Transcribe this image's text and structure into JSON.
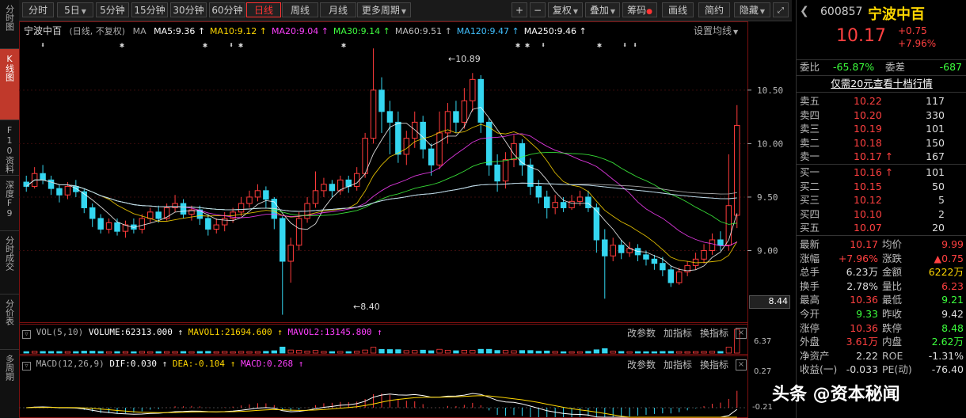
{
  "left_nav": [
    {
      "label": "分时图"
    },
    {
      "label": "K线图"
    },
    {
      "label": "F10资料"
    },
    {
      "label": "深度F9"
    },
    {
      "label": "分时成交"
    },
    {
      "label": "分价表"
    },
    {
      "label": "多周期"
    }
  ],
  "toolbar": {
    "periods": [
      "分时",
      "5日",
      "5分钟",
      "15分钟",
      "30分钟",
      "60分钟",
      "日线",
      "周线",
      "月线",
      "更多周期"
    ],
    "active_period": "日线",
    "right_buttons": [
      "复权",
      "叠加",
      "筹码",
      "画线",
      "简约",
      "隐藏"
    ],
    "plus": "+",
    "minus": "−"
  },
  "main_chart": {
    "title": "宁波中百",
    "subtitle": "(日线, 不复权)",
    "ma_label": "MA",
    "ma_items": [
      {
        "text": "MA5:9.36",
        "color": "#ffffff"
      },
      {
        "text": "MA10:9.12",
        "color": "#ffd700"
      },
      {
        "text": "MA20:9.04",
        "color": "#ff40ff"
      },
      {
        "text": "MA30:9.14",
        "color": "#40ff40"
      },
      {
        "text": "MA60:9.51",
        "color": "#c0c0c0"
      },
      {
        "text": "MA120:9.47",
        "color": "#40c0ff"
      },
      {
        "text": "MA250:9.46",
        "color": "#ffffff"
      }
    ],
    "settings_label": "设置均线",
    "y_ticks": [
      {
        "v": 10.5,
        "t": "10.50"
      },
      {
        "v": 10.0,
        "t": "10.00"
      },
      {
        "v": 9.5,
        "t": "9.50"
      },
      {
        "v": 9.0,
        "t": "9.00"
      }
    ],
    "y_range": [
      8.33,
      10.98
    ],
    "current_price_tag": "8.44",
    "high_annotation": "10.89",
    "low_annotation": "8.40"
  },
  "volume_panel": {
    "label": "VOL(5,10)",
    "volume": "VOLUME:62313.000",
    "mavol1": "MAVOL1:21694.600",
    "mavol2": "MAVOL2:13145.800",
    "ytick": "6.37",
    "buttons": [
      "改参数",
      "加指标",
      "换指标"
    ]
  },
  "macd_panel": {
    "label": "MACD(12,26,9)",
    "dif": "DIF:0.030",
    "dea": "DEA:-0.104",
    "macd": "MACD:0.268",
    "yticks": [
      "0.27",
      "-0.21"
    ],
    "buttons": [
      "改参数",
      "加指标",
      "换指标"
    ]
  },
  "quote": {
    "code": "600857",
    "name": "宁波中百",
    "price": "10.17",
    "change": "+0.75",
    "change_pct": "+7.96%",
    "weibi_label": "委比",
    "weibi": "-65.87%",
    "weicha_label": "委差",
    "weicha": "-687",
    "ten_level_link": "仅需20元查看十档行情",
    "sell": [
      {
        "label": "卖五",
        "price": "10.22",
        "vol": "117"
      },
      {
        "label": "卖四",
        "price": "10.20",
        "vol": "330"
      },
      {
        "label": "卖三",
        "price": "10.19",
        "vol": "101"
      },
      {
        "label": "卖二",
        "price": "10.18",
        "vol": "150"
      },
      {
        "label": "卖一",
        "price": "10.17",
        "vol": "167"
      }
    ],
    "buy": [
      {
        "label": "买一",
        "price": "10.16",
        "vol": "101"
      },
      {
        "label": "买二",
        "price": "10.15",
        "vol": "50"
      },
      {
        "label": "买三",
        "price": "10.12",
        "vol": "5"
      },
      {
        "label": "买四",
        "price": "10.10",
        "vol": "2"
      },
      {
        "label": "买五",
        "price": "10.07",
        "vol": "20"
      }
    ],
    "stats": [
      {
        "l1": "最新",
        "v1": "10.17",
        "c1": "red",
        "l2": "均价",
        "v2": "9.99",
        "c2": "red"
      },
      {
        "l1": "涨幅",
        "v1": "+7.96%",
        "c1": "red",
        "l2": "涨跌",
        "v2": "▲0.75",
        "c2": "red"
      },
      {
        "l1": "总手",
        "v1": "6.23万",
        "c1": "white",
        "l2": "金额",
        "v2": "6222万",
        "c2": "yellow"
      },
      {
        "l1": "换手",
        "v1": "2.78%",
        "c1": "white",
        "l2": "量比",
        "v2": "6.23",
        "c2": "red"
      },
      {
        "l1": "最高",
        "v1": "10.36",
        "c1": "red",
        "l2": "最低",
        "v2": "9.21",
        "c2": "green"
      },
      {
        "l1": "今开",
        "v1": "9.33",
        "c1": "green",
        "l2": "昨收",
        "v2": "9.42",
        "c2": "white"
      },
      {
        "l1": "涨停",
        "v1": "10.36",
        "c1": "red",
        "l2": "跌停",
        "v2": "8.48",
        "c2": "green"
      },
      {
        "l1": "外盘",
        "v1": "3.61万",
        "c1": "red",
        "l2": "内盘",
        "v2": "2.62万",
        "c2": "green"
      },
      {
        "l1": "净资产",
        "v1": "2.22",
        "c1": "white",
        "l2": "ROE",
        "v2": "-1.31%",
        "c2": "white"
      },
      {
        "l1": "收益(一)",
        "v1": "-0.033",
        "c1": "white",
        "l2": "PE(动)",
        "v2": "-76.40",
        "c2": "white"
      }
    ]
  },
  "watermark": "头条 @资本秘闻",
  "chart_data": {
    "type": "candlestick",
    "series": [
      {
        "o": 9.64,
        "c": 9.6,
        "h": 9.7,
        "l": 9.55
      },
      {
        "o": 9.6,
        "c": 9.72,
        "h": 9.78,
        "l": 9.58
      },
      {
        "o": 9.72,
        "c": 9.66,
        "h": 9.8,
        "l": 9.62
      },
      {
        "o": 9.66,
        "c": 9.58,
        "h": 9.7,
        "l": 9.52
      },
      {
        "o": 9.58,
        "c": 9.52,
        "h": 9.62,
        "l": 9.45
      },
      {
        "o": 9.52,
        "c": 9.6,
        "h": 9.64,
        "l": 9.48
      },
      {
        "o": 9.6,
        "c": 9.55,
        "h": 9.66,
        "l": 9.5
      },
      {
        "o": 9.55,
        "c": 9.4,
        "h": 9.58,
        "l": 9.35
      },
      {
        "o": 9.4,
        "c": 9.3,
        "h": 9.44,
        "l": 9.22
      },
      {
        "o": 9.3,
        "c": 9.2,
        "h": 9.34,
        "l": 9.16
      },
      {
        "o": 9.2,
        "c": 9.26,
        "h": 9.3,
        "l": 9.16
      },
      {
        "o": 9.26,
        "c": 9.18,
        "h": 9.3,
        "l": 9.14
      },
      {
        "o": 9.18,
        "c": 9.24,
        "h": 9.28,
        "l": 9.12
      },
      {
        "o": 9.24,
        "c": 9.2,
        "h": 9.3,
        "l": 9.16
      },
      {
        "o": 9.2,
        "c": 9.3,
        "h": 9.34,
        "l": 9.16
      },
      {
        "o": 9.3,
        "c": 9.36,
        "h": 9.4,
        "l": 9.26
      },
      {
        "o": 9.36,
        "c": 9.3,
        "h": 9.42,
        "l": 9.26
      },
      {
        "o": 9.3,
        "c": 9.4,
        "h": 9.44,
        "l": 9.28
      },
      {
        "o": 9.4,
        "c": 9.44,
        "h": 9.52,
        "l": 9.36
      },
      {
        "o": 9.44,
        "c": 9.34,
        "h": 9.48,
        "l": 9.3
      },
      {
        "o": 9.34,
        "c": 9.38,
        "h": 9.42,
        "l": 9.28
      },
      {
        "o": 9.38,
        "c": 9.3,
        "h": 9.42,
        "l": 9.24
      },
      {
        "o": 9.3,
        "c": 9.2,
        "h": 9.34,
        "l": 9.14
      },
      {
        "o": 9.2,
        "c": 9.24,
        "h": 9.3,
        "l": 9.16
      },
      {
        "o": 9.24,
        "c": 9.3,
        "h": 9.36,
        "l": 9.18
      },
      {
        "o": 9.3,
        "c": 9.36,
        "h": 9.4,
        "l": 9.26
      },
      {
        "o": 9.36,
        "c": 9.44,
        "h": 9.5,
        "l": 9.32
      },
      {
        "o": 9.44,
        "c": 9.5,
        "h": 9.56,
        "l": 9.4
      },
      {
        "o": 9.5,
        "c": 9.56,
        "h": 9.62,
        "l": 9.46
      },
      {
        "o": 9.56,
        "c": 9.48,
        "h": 9.6,
        "l": 9.4
      },
      {
        "o": 9.48,
        "c": 9.3,
        "h": 9.5,
        "l": 9.2
      },
      {
        "o": 9.3,
        "c": 8.9,
        "h": 9.32,
        "l": 8.4
      },
      {
        "o": 8.9,
        "c": 9.05,
        "h": 9.12,
        "l": 8.7
      },
      {
        "o": 9.05,
        "c": 9.3,
        "h": 9.36,
        "l": 9.0
      },
      {
        "o": 9.3,
        "c": 9.44,
        "h": 9.5,
        "l": 9.26
      },
      {
        "o": 9.44,
        "c": 9.56,
        "h": 9.74,
        "l": 9.4
      },
      {
        "o": 9.56,
        "c": 9.62,
        "h": 9.68,
        "l": 9.5
      },
      {
        "o": 9.62,
        "c": 9.56,
        "h": 9.66,
        "l": 9.5
      },
      {
        "o": 9.56,
        "c": 9.66,
        "h": 9.7,
        "l": 9.52
      },
      {
        "o": 9.66,
        "c": 9.6,
        "h": 9.7,
        "l": 9.54
      },
      {
        "o": 9.6,
        "c": 9.72,
        "h": 9.78,
        "l": 9.56
      },
      {
        "o": 9.72,
        "c": 10.05,
        "h": 10.1,
        "l": 9.68
      },
      {
        "o": 10.05,
        "c": 10.5,
        "h": 10.89,
        "l": 10.0
      },
      {
        "o": 10.5,
        "c": 10.3,
        "h": 10.62,
        "l": 10.1
      },
      {
        "o": 10.3,
        "c": 10.2,
        "h": 10.4,
        "l": 9.9
      },
      {
        "o": 10.2,
        "c": 9.9,
        "h": 10.3,
        "l": 9.82
      },
      {
        "o": 9.9,
        "c": 10.05,
        "h": 10.12,
        "l": 9.8
      },
      {
        "o": 10.05,
        "c": 10.2,
        "h": 10.3,
        "l": 9.96
      },
      {
        "o": 10.2,
        "c": 9.95,
        "h": 10.26,
        "l": 9.86
      },
      {
        "o": 9.95,
        "c": 9.8,
        "h": 10.0,
        "l": 9.7
      },
      {
        "o": 9.8,
        "c": 10.1,
        "h": 10.3,
        "l": 9.76
      },
      {
        "o": 10.1,
        "c": 10.3,
        "h": 10.38,
        "l": 10.0
      },
      {
        "o": 10.3,
        "c": 10.2,
        "h": 10.4,
        "l": 10.1
      },
      {
        "o": 10.2,
        "c": 10.4,
        "h": 10.52,
        "l": 10.14
      },
      {
        "o": 10.4,
        "c": 10.6,
        "h": 10.66,
        "l": 10.3
      },
      {
        "o": 10.6,
        "c": 10.2,
        "h": 10.64,
        "l": 10.1
      },
      {
        "o": 10.2,
        "c": 9.8,
        "h": 10.24,
        "l": 9.7
      },
      {
        "o": 9.8,
        "c": 9.65,
        "h": 9.9,
        "l": 9.55
      },
      {
        "o": 9.65,
        "c": 9.85,
        "h": 9.92,
        "l": 9.58
      },
      {
        "o": 9.85,
        "c": 10.0,
        "h": 10.08,
        "l": 9.78
      },
      {
        "o": 10.0,
        "c": 9.8,
        "h": 10.04,
        "l": 9.7
      },
      {
        "o": 9.8,
        "c": 9.6,
        "h": 9.86,
        "l": 9.52
      },
      {
        "o": 9.6,
        "c": 9.5,
        "h": 9.66,
        "l": 9.44
      },
      {
        "o": 9.5,
        "c": 9.4,
        "h": 9.56,
        "l": 9.3
      },
      {
        "o": 9.4,
        "c": 9.45,
        "h": 9.52,
        "l": 9.34
      },
      {
        "o": 9.45,
        "c": 9.4,
        "h": 9.5,
        "l": 9.36
      },
      {
        "o": 9.4,
        "c": 9.46,
        "h": 9.52,
        "l": 9.38
      },
      {
        "o": 9.46,
        "c": 9.5,
        "h": 9.56,
        "l": 9.42
      },
      {
        "o": 9.5,
        "c": 9.4,
        "h": 9.56,
        "l": 9.36
      },
      {
        "o": 9.4,
        "c": 9.1,
        "h": 9.44,
        "l": 8.98
      },
      {
        "o": 9.1,
        "c": 8.95,
        "h": 9.2,
        "l": 8.55
      },
      {
        "o": 8.95,
        "c": 9.05,
        "h": 9.12,
        "l": 8.9
      },
      {
        "o": 9.05,
        "c": 8.98,
        "h": 9.1,
        "l": 8.92
      },
      {
        "o": 8.98,
        "c": 9.02,
        "h": 9.08,
        "l": 8.94
      },
      {
        "o": 9.02,
        "c": 8.96,
        "h": 9.06,
        "l": 8.9
      },
      {
        "o": 8.96,
        "c": 8.92,
        "h": 9.0,
        "l": 8.86
      },
      {
        "o": 8.92,
        "c": 8.88,
        "h": 8.96,
        "l": 8.82
      },
      {
        "o": 8.88,
        "c": 8.82,
        "h": 8.94,
        "l": 8.76
      },
      {
        "o": 8.82,
        "c": 8.7,
        "h": 8.86,
        "l": 8.66
      },
      {
        "o": 8.7,
        "c": 8.8,
        "h": 8.84,
        "l": 8.68
      },
      {
        "o": 8.8,
        "c": 8.86,
        "h": 8.9,
        "l": 8.76
      },
      {
        "o": 8.86,
        "c": 8.92,
        "h": 8.98,
        "l": 8.82
      },
      {
        "o": 8.92,
        "c": 9.0,
        "h": 9.06,
        "l": 8.88
      },
      {
        "o": 9.0,
        "c": 9.1,
        "h": 9.16,
        "l": 8.96
      },
      {
        "o": 9.1,
        "c": 9.05,
        "h": 9.18,
        "l": 9.0
      },
      {
        "o": 9.05,
        "c": 9.42,
        "h": 9.9,
        "l": 9.0
      },
      {
        "o": 9.33,
        "c": 10.17,
        "h": 10.36,
        "l": 9.21
      }
    ]
  }
}
